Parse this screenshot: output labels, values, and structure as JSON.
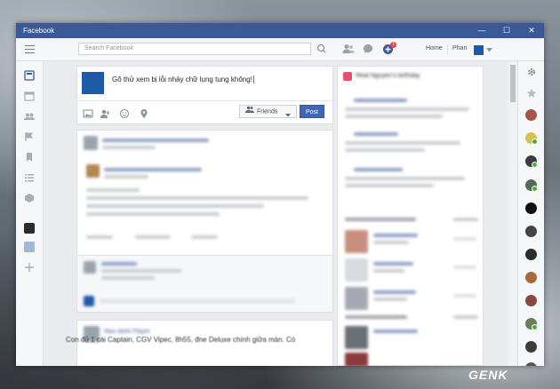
{
  "window": {
    "title": "Facebook"
  },
  "window_controls": {
    "minimize": "—",
    "maximize": "☐",
    "close": "✕"
  },
  "topbar": {
    "search_placeholder": "Search Facebook",
    "nav": {
      "home": "Home",
      "profile": "Phan"
    },
    "notification_count": "1"
  },
  "composer": {
    "text": "Gõ thử xem bị lỗi nhảy chữ lung tung không!",
    "audience": "Friends",
    "post_label": "Post"
  },
  "sidebar_blurred": {
    "header": "Nhat Nguyen's birthday"
  },
  "post2": {
    "author": "Max dietè Player"
  },
  "feed_bottom": {
    "caption": "Con đủ 1 cái Captain, CGV Vipec, 8h55, đne Deluxe chính giữa màn. Có"
  },
  "watermark": {
    "brand": "GENK"
  },
  "icons": [
    "hamburger-icon",
    "search-icon",
    "friend-requests-icon",
    "messages-icon",
    "notifications-icon",
    "dropdown-icon",
    "newsfeed-icon",
    "events-icon",
    "groups-icon",
    "pages-icon",
    "saved-icon",
    "lists-icon",
    "apps-icon",
    "add-icon",
    "settings-icon",
    "star-icon",
    "photo-icon",
    "tag-friends-icon",
    "feeling-icon",
    "location-icon",
    "friends-audience-icon"
  ],
  "colors": {
    "brand": "#3b5998",
    "post_button": "#4267b2",
    "online": "#42b72a",
    "badge": "#fa3e3e"
  }
}
